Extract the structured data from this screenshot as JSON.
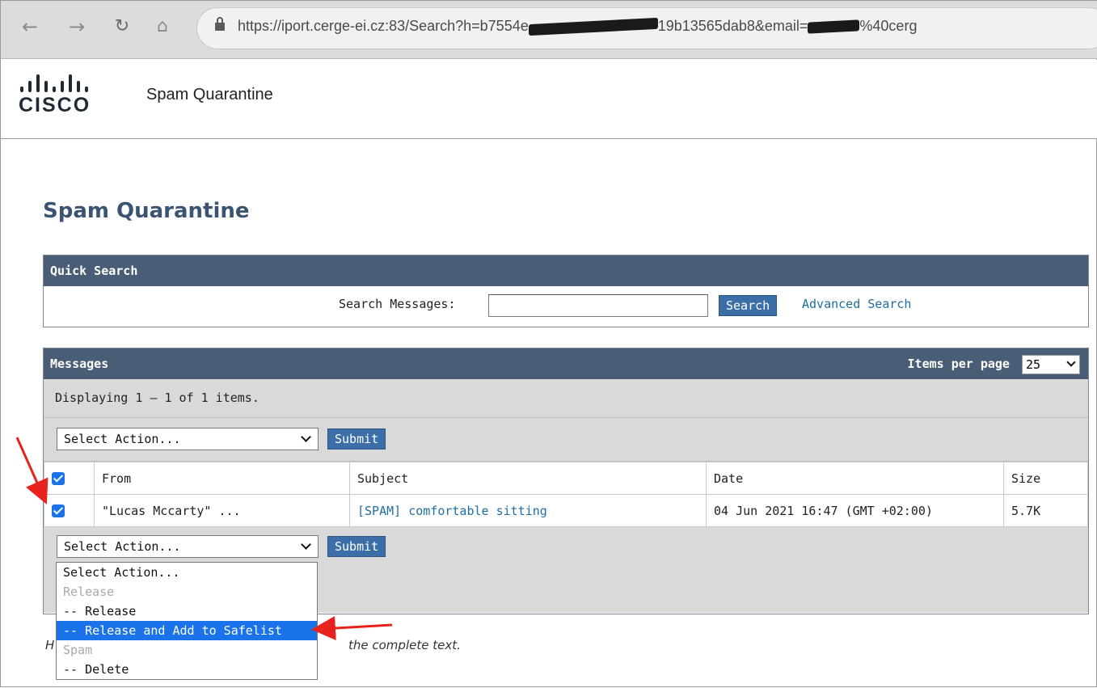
{
  "browser": {
    "url_start": "https://iport.cerge-ei.cz:83/Search?h=b7554e",
    "url_mid": "19b13565dab8&email=",
    "url_end": "%40cerg"
  },
  "app": {
    "logo_text": "CISCO",
    "title": "Spam Quarantine"
  },
  "page": {
    "title": "Spam Quarantine"
  },
  "quick_search": {
    "heading": "Quick Search",
    "label": "Search Messages:",
    "value": "",
    "search_button": "Search",
    "advanced_link": "Advanced Search"
  },
  "messages": {
    "heading": "Messages",
    "items_per_page_label": "Items per page",
    "items_per_page_value": "25",
    "displaying": "Displaying 1 — 1 of 1 items.",
    "action_select": "Select Action...",
    "submit": "Submit",
    "columns": [
      "From",
      "Subject",
      "Date",
      "Size"
    ],
    "rows": [
      {
        "from": "\"Lucas Mccarty\" ...",
        "subject": "[SPAM] comfortable sitting",
        "date": "04 Jun 2021 16:47 (GMT +02:00)",
        "size": "5.7K",
        "checked": true
      }
    ],
    "header_checked": true
  },
  "action_dropdown": {
    "options": [
      {
        "label": "Select Action...",
        "kind": "option"
      },
      {
        "label": "Release",
        "kind": "group"
      },
      {
        "label": "-- Release",
        "kind": "option"
      },
      {
        "label": "-- Release and Add to Safelist",
        "kind": "selected"
      },
      {
        "label": "Spam",
        "kind": "group"
      },
      {
        "label": "-- Delete",
        "kind": "option"
      }
    ]
  },
  "footnote": {
    "prefix": "H",
    "text": "the complete text."
  },
  "colors": {
    "panel_header": "#4a5d76",
    "title": "#3a5471",
    "link": "#1e6fa0",
    "button": "#3c6fa8",
    "highlight": "#1a73e8",
    "arrow": "#e8231e"
  }
}
